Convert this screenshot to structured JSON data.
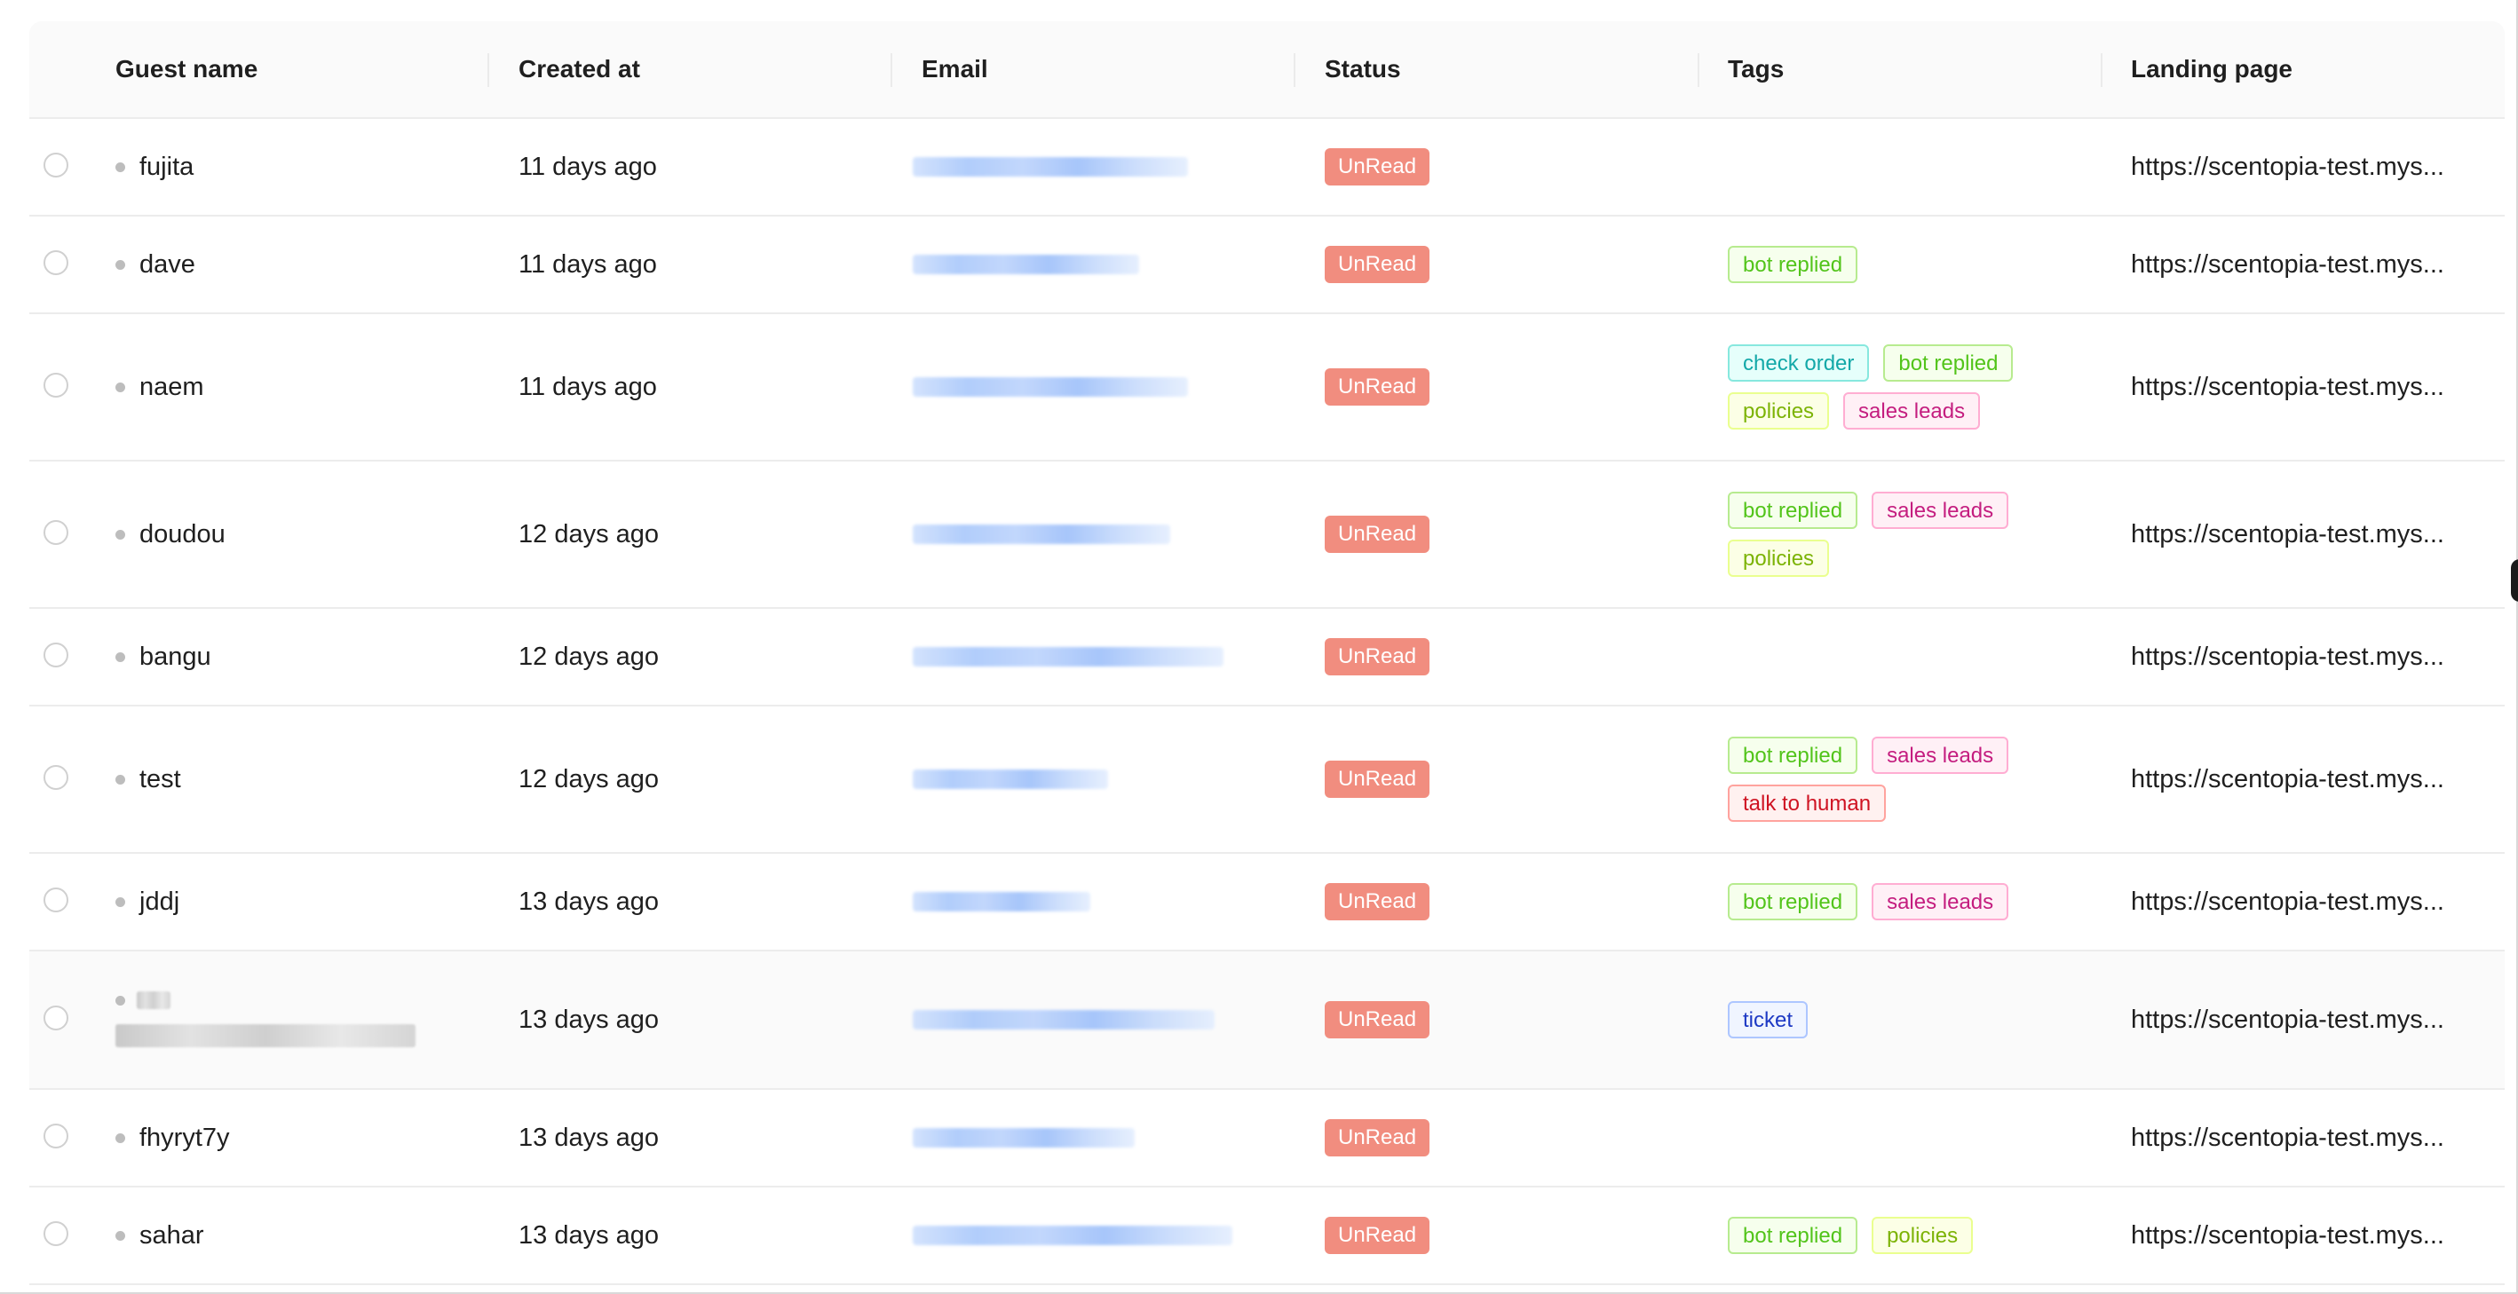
{
  "columns": {
    "guest_name": "Guest name",
    "created_at": "Created at",
    "email": "Email",
    "status": "Status",
    "tags": "Tags",
    "landing_page": "Landing page"
  },
  "colors": {
    "unread_badge": "#f18d7f",
    "row_hover": "#fafafa"
  },
  "rows": [
    {
      "name": "fujita",
      "created": "11 days ago",
      "status": "UnRead",
      "tags": [],
      "landing": "https://scentopia-test.mys..."
    },
    {
      "name": "dave",
      "created": "11 days ago",
      "status": "UnRead",
      "tags": [
        [
          "bot replied"
        ]
      ],
      "landing": "https://scentopia-test.mys..."
    },
    {
      "name": "naem",
      "created": "11 days ago",
      "status": "UnRead",
      "tags": [
        [
          "check order",
          "bot replied"
        ],
        [
          "policies",
          "sales leads"
        ]
      ],
      "landing": "https://scentopia-test.mys..."
    },
    {
      "name": "doudou",
      "created": "12 days ago",
      "status": "UnRead",
      "tags": [
        [
          "bot replied",
          "sales leads"
        ],
        [
          "policies"
        ]
      ],
      "landing": "https://scentopia-test.mys..."
    },
    {
      "name": "bangu",
      "created": "12 days ago",
      "status": "UnRead",
      "tags": [],
      "landing": "https://scentopia-test.mys..."
    },
    {
      "name": "test",
      "created": "12 days ago",
      "status": "UnRead",
      "tags": [
        [
          "bot replied",
          "sales leads"
        ],
        [
          "talk to human"
        ]
      ],
      "landing": "https://scentopia-test.mys..."
    },
    {
      "name": "jddj",
      "created": "13 days ago",
      "status": "UnRead",
      "tags": [
        [
          "bot replied",
          "sales leads"
        ]
      ],
      "landing": "https://scentopia-test.mys..."
    },
    {
      "name": "",
      "created": "13 days ago",
      "status": "UnRead",
      "tags": [
        [
          "ticket"
        ]
      ],
      "landing": "https://scentopia-test.mys..."
    },
    {
      "name": "fhyryt7y",
      "created": "13 days ago",
      "status": "UnRead",
      "tags": [],
      "landing": "https://scentopia-test.mys..."
    },
    {
      "name": "sahar",
      "created": "13 days ago",
      "status": "UnRead",
      "tags": [
        [
          "bot replied",
          "policies"
        ]
      ],
      "landing": "https://scentopia-test.mys..."
    }
  ]
}
